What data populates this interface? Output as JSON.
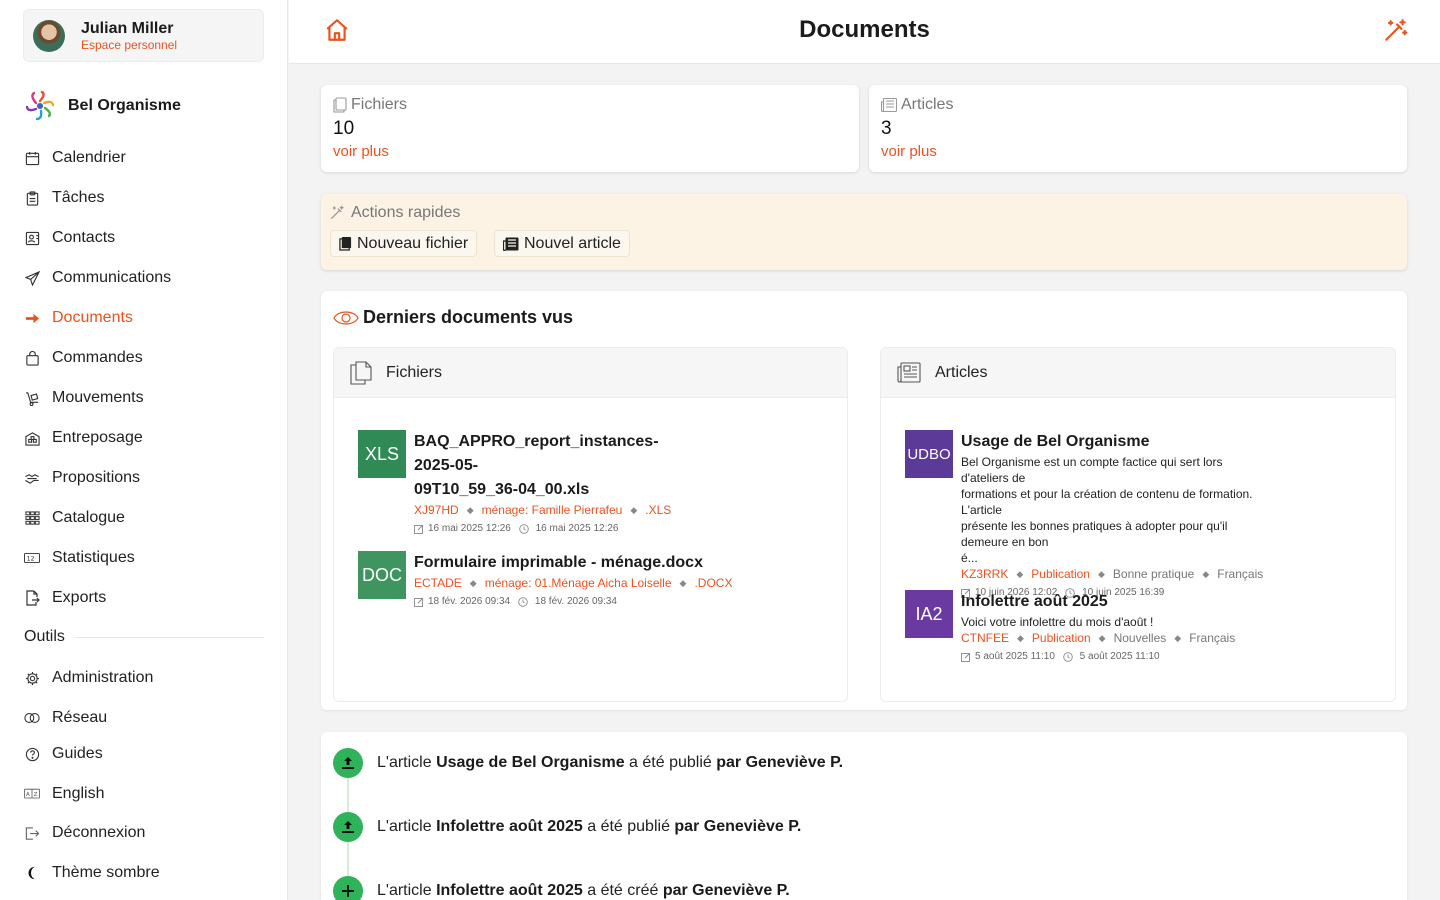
{
  "user": {
    "name": "Julian Miller",
    "subtitle": "Espace personnel"
  },
  "org": {
    "name": "Bel Organisme"
  },
  "nav": [
    {
      "key": "calendrier",
      "label": "Calendrier",
      "icon": "calendar-icon"
    },
    {
      "key": "taches",
      "label": "Tâches",
      "icon": "clipboard-icon"
    },
    {
      "key": "contacts",
      "label": "Contacts",
      "icon": "contact-card-icon"
    },
    {
      "key": "communications",
      "label": "Communications",
      "icon": "send-icon"
    },
    {
      "key": "documents",
      "label": "Documents",
      "icon": "arrow-right-icon",
      "active": true
    },
    {
      "key": "commandes",
      "label": "Commandes",
      "icon": "shopping-bag-icon"
    },
    {
      "key": "mouvements",
      "label": "Mouvements",
      "icon": "hand-truck-icon"
    },
    {
      "key": "entreposage",
      "label": "Entreposage",
      "icon": "warehouse-icon"
    },
    {
      "key": "propositions",
      "label": "Propositions",
      "icon": "handshake-icon"
    },
    {
      "key": "catalogue",
      "label": "Catalogue",
      "icon": "grid-icon"
    },
    {
      "key": "statistiques",
      "label": "Statistiques",
      "icon": "counter-icon"
    },
    {
      "key": "exports",
      "label": "Exports",
      "icon": "file-export-icon"
    }
  ],
  "tools_label": "Outils",
  "tools": [
    {
      "key": "administration",
      "label": "Administration",
      "icon": "gear-icon"
    },
    {
      "key": "reseau",
      "label": "Réseau",
      "icon": "network-icon"
    },
    {
      "key": "guides",
      "label": "Guides",
      "icon": "help-icon"
    },
    {
      "key": "english",
      "label": "English",
      "icon": "translate-icon"
    },
    {
      "key": "deconnexion",
      "label": "Déconnexion",
      "icon": "logout-icon"
    },
    {
      "key": "theme",
      "label": "Thème sombre",
      "icon": "moon-icon"
    }
  ],
  "header": {
    "title": "Documents"
  },
  "stats": {
    "files": {
      "label": "Fichiers",
      "value": "10",
      "link": "voir plus"
    },
    "articles": {
      "label": "Articles",
      "value": "3",
      "link": "voir plus"
    }
  },
  "quick": {
    "title": "Actions rapides",
    "new_file": "Nouveau fichier",
    "new_article": "Nouvel article"
  },
  "recent": {
    "title": "Derniers documents vus",
    "files_header": "Fichiers",
    "articles_header": "Articles",
    "files": [
      {
        "badge": "XLS",
        "badge_color": "#2f8a55",
        "title_line1": "BAQ_APPRO_report_instances-2025-05-",
        "title_line2": "09T10_59_36-04_00.xls",
        "code": "XJ97HD",
        "category": "ménage: Famille Pierrafeu",
        "ext": ".XLS",
        "modified": "16 mai 2025 12:26",
        "created": "16 mai 2025 12:26"
      },
      {
        "badge": "DOC",
        "badge_color": "#3e955f",
        "title_line1": "Formulaire imprimable - ménage.docx",
        "code": "ECTADE",
        "category": "ménage: 01.Ménage Aicha Loiselle",
        "ext": ".DOCX",
        "modified": "18 fév. 2026 09:34",
        "created": "18 fév. 2026 09:34"
      }
    ],
    "articles": [
      {
        "badge": "UDBO",
        "badge_color": "#5b3a98",
        "title": "Usage de Bel Organisme",
        "desc_1": "Bel Organisme est un compte factice qui sert lors d'ateliers de",
        "desc_2": "formations et pour la création de contenu de formation. L'article",
        "desc_3": "présente les bonnes pratiques à adopter pour qu'il demeure en bon",
        "desc_4": "é...",
        "code": "KZ3RRK",
        "status": "Publication",
        "tag": "Bonne pratique",
        "lang": "Français",
        "modified": "10 juin 2026 12:02",
        "created": "10 juin 2025 16:39"
      },
      {
        "badge": "IA2",
        "badge_color": "#6a3aa0",
        "title": "Infolettre août 2025",
        "desc_1": "Voici votre infolettre du mois d'août !",
        "code": "CTNFEE",
        "status": "Publication",
        "tag": "Nouvelles",
        "lang": "Français",
        "modified": "5 août 2025 11:10",
        "created": "5 août 2025 11:10"
      }
    ]
  },
  "activity": [
    {
      "prefix": "L'article ",
      "subject": "Usage de Bel Organisme",
      "middle": " a été publié ",
      "by": "par Geneviève P.",
      "icon": "upload-icon"
    },
    {
      "prefix": "L'article ",
      "subject": "Infolettre août 2025",
      "middle": " a été publié ",
      "by": "par Geneviève P.",
      "icon": "upload-icon"
    },
    {
      "prefix": "L'article ",
      "subject": "Infolettre août 2025",
      "middle": " a été créé ",
      "by": "par Geneviève P.",
      "icon": "plus-icon"
    }
  ],
  "colors": {
    "accent": "#e8541d",
    "success": "#2fb35a",
    "quick_bg": "#fcf3e4"
  }
}
